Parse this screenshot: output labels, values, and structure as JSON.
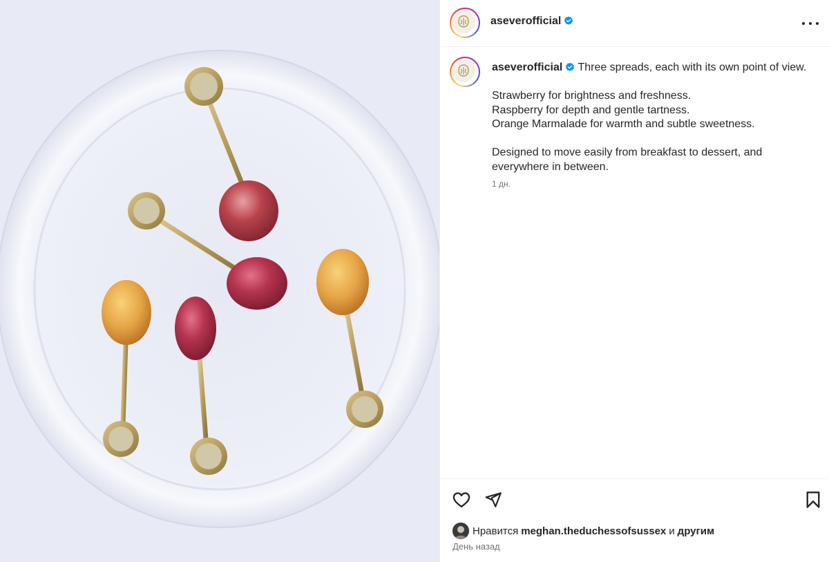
{
  "post": {
    "author": {
      "username": "aseverofficial",
      "verified": true
    },
    "caption": {
      "username": "aseverofficial",
      "first_line": "Three spreads, each with its own point of view.",
      "lines": [
        "Strawberry for brightness and freshness.",
        "Raspberry for depth and gentle tartness.",
        "Orange Marmalade for warmth and subtle sweetness."
      ],
      "closing": [
        "Designed to move easily from breakfast to dessert, and",
        "everywhere in between."
      ],
      "time": "1 дн."
    },
    "likes": {
      "prefix": "Нравится",
      "user": "meghan.theduchessofsussex",
      "conjunction": "и",
      "others": "другим"
    },
    "date_label": "День назад",
    "icons": {
      "verified": "verified-badge-icon",
      "more": "more-options-icon",
      "like": "heart-icon",
      "share": "send-icon",
      "save": "bookmark-icon"
    },
    "colors": {
      "verified_blue": "#0095f6",
      "text": "#262626",
      "secondary_text": "#737373",
      "border": "#efefef"
    }
  }
}
